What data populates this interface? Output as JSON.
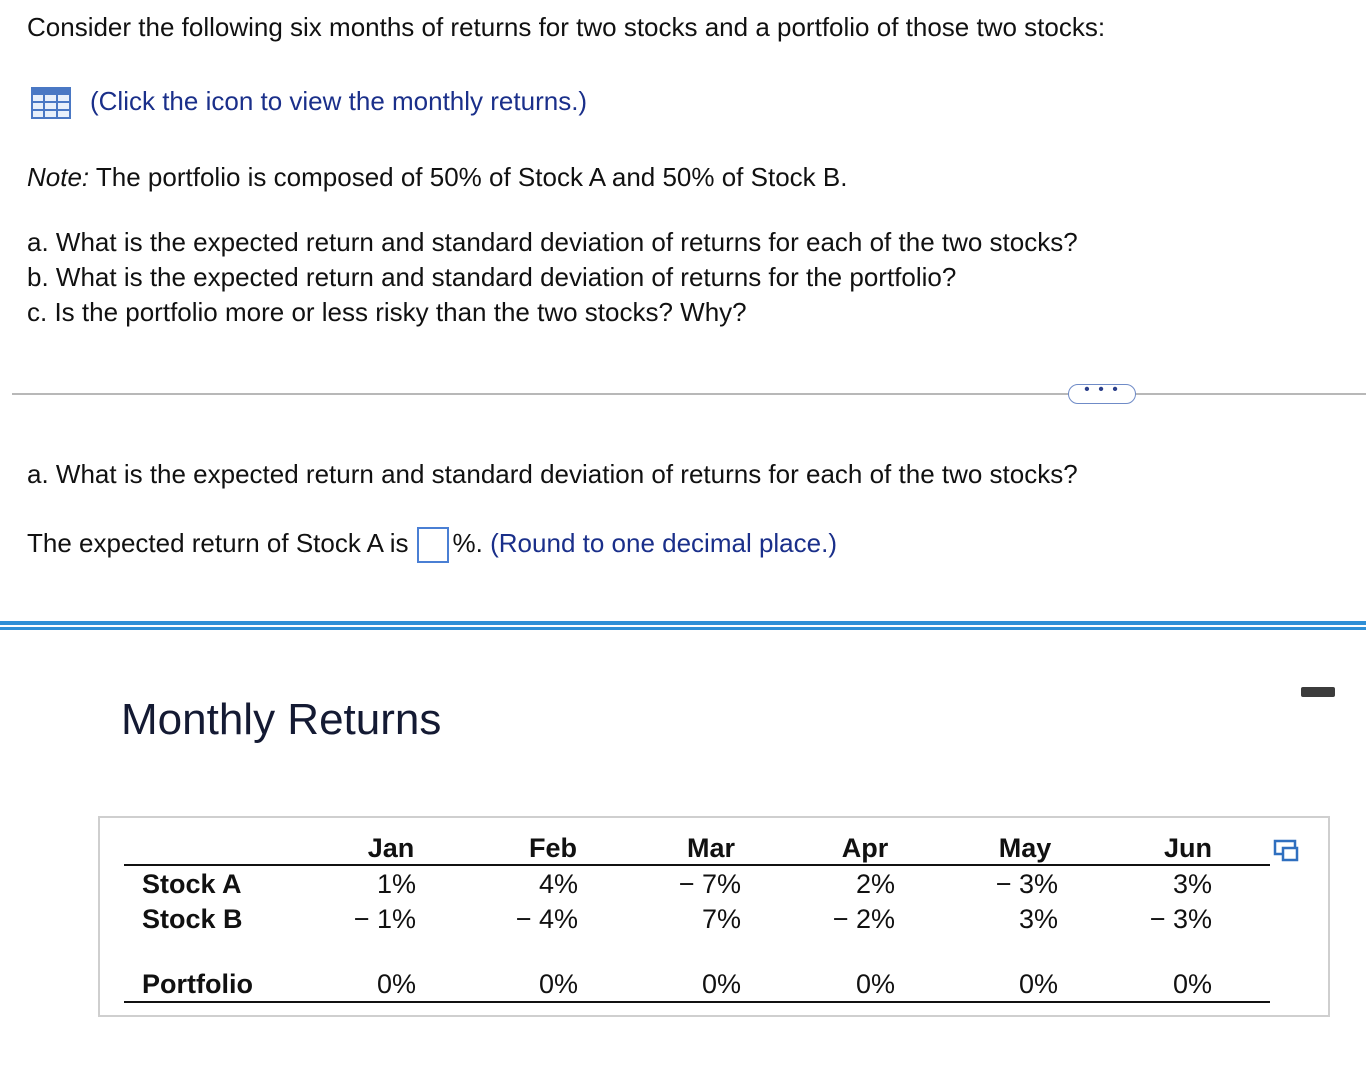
{
  "question": {
    "intro": "Consider the following six months of returns for two stocks and a portfolio of those two stocks:",
    "icon_link": "(Click the icon to view the monthly returns.)",
    "note_label": "Note:",
    "note_text": " The portfolio is composed of 50% of Stock A and 50% of Stock B.",
    "part_a": "a. What is the expected return and standard deviation of returns for each of the two stocks?",
    "part_b": "b. What is the expected return and standard deviation of returns for the portfolio?",
    "part_c": "c. Is the portfolio more or less risky than the two stocks? Why?"
  },
  "more_button": "• • •",
  "answer": {
    "heading": "a. What is the expected return and standard deviation of returns for each of the two stocks?",
    "prefix": "The expected return of Stock A is",
    "input_value": "",
    "suffix": "%.",
    "hint": "(Round to one decimal place.)"
  },
  "popup": {
    "title": "Monthly Returns",
    "table": {
      "columns": [
        "Jan",
        "Feb",
        "Mar",
        "Apr",
        "May",
        "Jun"
      ],
      "rows": [
        {
          "label": "Stock A",
          "values": [
            "1%",
            "4%",
            "− 7%",
            "2%",
            "− 3%",
            "3%"
          ]
        },
        {
          "label": "Stock B",
          "values": [
            "− 1%",
            "− 4%",
            "7%",
            "− 2%",
            "3%",
            "− 3%"
          ]
        },
        {
          "label": "Portfolio",
          "values": [
            "0%",
            "0%",
            "0%",
            "0%",
            "0%",
            "0%"
          ]
        }
      ]
    }
  },
  "icons": {
    "table_icon": "table-grid-icon",
    "copy_icon": "copy-icon",
    "minimize": "minimize-icon"
  },
  "colors": {
    "link_blue": "#1a2f8a",
    "accent_blue": "#2f8fd6",
    "input_border": "#4a7fd4"
  }
}
